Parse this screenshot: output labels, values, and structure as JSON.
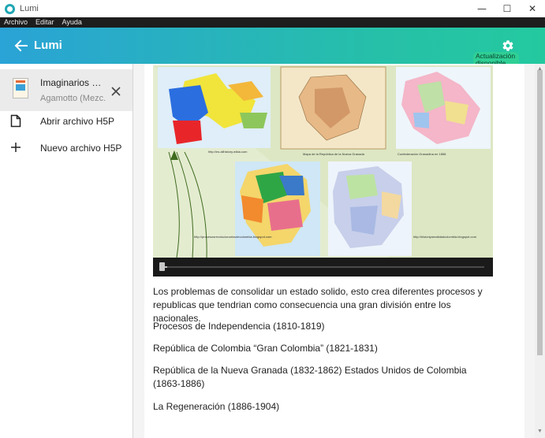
{
  "window": {
    "title": "Lumi"
  },
  "menu": [
    "Archivo",
    "Editar",
    "Ayuda"
  ],
  "appbar": {
    "title": "Lumi",
    "update_label": "Actualización disponible"
  },
  "sidebar": {
    "active_file": {
      "title": "Imaginarios d...",
      "subtitle": "Agamotto (Mezc..."
    },
    "items": [
      {
        "label": "Abrir archivo H5P",
        "icon": "file-icon"
      },
      {
        "label": "Nuevo archivo H5P",
        "icon": "plus-icon"
      }
    ]
  },
  "player": {
    "progress": 0.02
  },
  "content": {
    "paragraphs": [
      "Los problemas de consolidar un estado solido, esto crea diferentes procesos y republicas que tendrian como consecuencia una gran división entre los nacionales.",
      "Procesos de Independencia (1810-1819)",
      "República de Colombia “Gran Colombia” (1821-1831)",
      "República de la Nueva Granada (1832-1862) Estados Unidos de Colombia (1863-1886)",
      "La Regeneración (1886-1904)"
    ]
  },
  "colors": {
    "appbar_start": "#2aa3d6",
    "appbar_end": "#24c9a0",
    "badge": "#2fcf95"
  }
}
